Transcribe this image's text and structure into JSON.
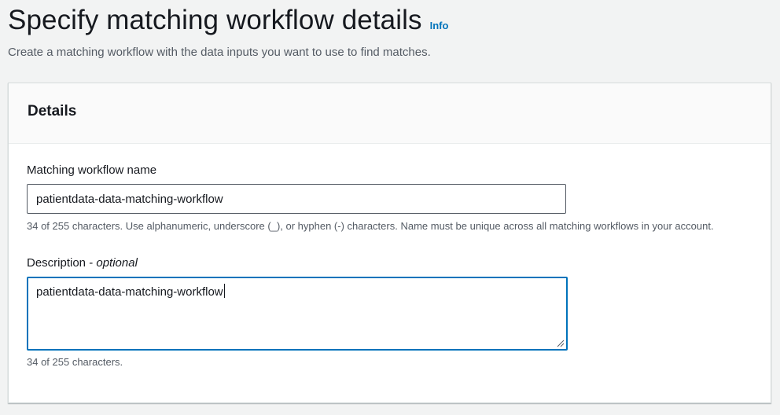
{
  "page": {
    "title": "Specify matching workflow details",
    "info_link": "Info",
    "subtitle": "Create a matching workflow with the data inputs you want to use to find matches."
  },
  "details": {
    "heading": "Details",
    "name_field": {
      "label": "Matching workflow name",
      "value": "patientdata-data-matching-workflow",
      "constraint": "34 of 255 characters. Use alphanumeric, underscore (_), or hyphen (-) characters. Name must be unique across all matching workflows in your account."
    },
    "description_field": {
      "label": "Description - ",
      "label_optional": "optional",
      "value": "patientdata-data-matching-workflow",
      "constraint": "34 of 255 characters."
    }
  },
  "colors": {
    "link": "#0073bb",
    "focus_border": "#0073bb",
    "background": "#f2f3f3"
  }
}
